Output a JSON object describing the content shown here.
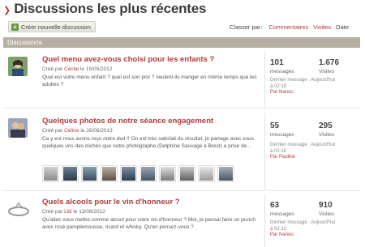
{
  "page": {
    "title": "Discussions les plus récentes"
  },
  "toolbar": {
    "new_label": "Créer nouvelle discussion"
  },
  "sort": {
    "label": "Classer par:",
    "options": [
      "Commentaires",
      "Visites",
      "Date"
    ]
  },
  "section": {
    "title": "Discussions"
  },
  "topics": [
    {
      "title": "Quel menu avez-vous choisi pour les enfants ?",
      "created_prefix": "Créé par",
      "author": "Cécile",
      "date": "le 15/05/2012",
      "excerpt": "Quel est votre menu enfant ? quel est son prix ? veulent-ils manger en même temps que les adultes ?",
      "messages": "101",
      "messages_label": "messages",
      "visits": "1.676",
      "visits_label": "Visites",
      "last_label": "Dernier message : Aujourd'hui",
      "last_time": "à 02:18",
      "last_by": "Par Nanou"
    },
    {
      "title": "Quelques photos de notre séance engagement",
      "created_prefix": "Créé par",
      "author": "Céline",
      "date": "le 26/06/2013",
      "excerpt": "Ca y est nous avons reçu notre dvd !! On est très satisfait du résultat, je partage avec vous quelques uns des clichés que notre photographe (Delphine Sauvage à Brest) a prise de...",
      "messages": "55",
      "messages_label": "messages",
      "visits": "295",
      "visits_label": "Visites",
      "last_label": "Dernier message : Aujourd'hui",
      "last_time": "à 02:16",
      "last_by": "Par Pauline"
    },
    {
      "title": "Quels alcools pour le vin d'honneur ?",
      "created_prefix": "Créé par",
      "author": "Lilli",
      "date": "le 13/08/2012",
      "excerpt": "Qu'allez vous mettre comme alcool pour votre vin d'honneur ? Moi, je pensai faire un punch avec rosé pamplemousse, ricard et whisky. Qu'en pensez-vous ?",
      "messages": "63",
      "messages_label": "messages",
      "visits": "910",
      "visits_label": "Visites",
      "last_label": "Dernier message : Aujourd'hui",
      "last_time": "à 02:12",
      "last_by": "Par Nanou"
    }
  ],
  "colors": {
    "accent": "#b03a3a",
    "section_bar": "#b6b0a4",
    "button_icon": "#6b9c3c"
  }
}
